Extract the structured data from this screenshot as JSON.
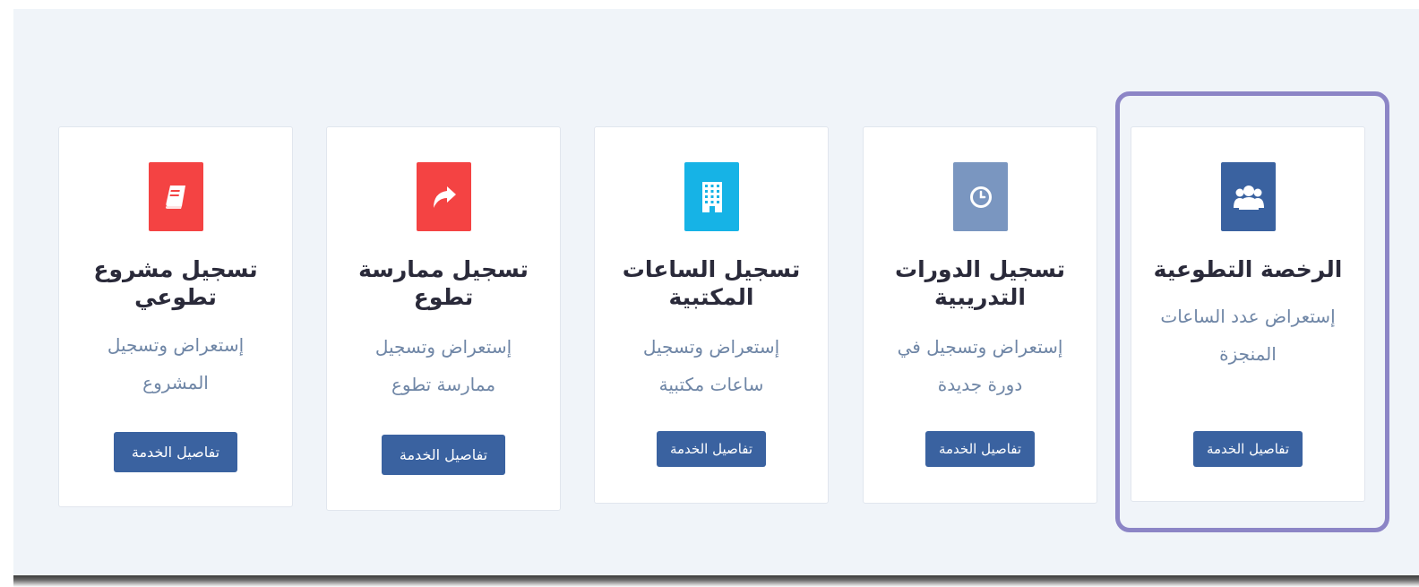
{
  "colors": {
    "background": "#f0f4f9",
    "button": "#3a62a0",
    "highlight": "#8c85c6",
    "description": "#6f86a6"
  },
  "services": [
    {
      "icon": "users-icon",
      "icon_color": "#3a62a0",
      "title_lines": [
        "الرخصة التطوعية"
      ],
      "desc_lines": [
        "إستعراض عدد الساعات",
        "المنجزة"
      ],
      "button_label": "تفاصيل الخدمة"
    },
    {
      "icon": "clock-icon",
      "icon_color": "#7a96c0",
      "title_lines": [
        "تسجيل الدورات",
        "التدريبية"
      ],
      "desc_lines": [
        "إستعراض وتسجيل في",
        "دورة جديدة"
      ],
      "button_label": "تفاصيل الخدمة"
    },
    {
      "icon": "building-icon",
      "icon_color": "#16b3e6",
      "title_lines": [
        "تسجيل الساعات",
        "المكتبية"
      ],
      "desc_lines": [
        "إستعراض وتسجيل",
        "ساعات مكتبية"
      ],
      "button_label": "تفاصيل الخدمة"
    },
    {
      "icon": "share-arrow-icon",
      "icon_color": "#f44343",
      "title_lines": [
        "تسجيل ممارسة",
        "تطوع"
      ],
      "desc_lines": [
        "إستعراض وتسجيل",
        "ممارسة تطوع"
      ],
      "button_label": "تفاصيل الخدمة"
    },
    {
      "icon": "book-icon",
      "icon_color": "#f44343",
      "title_lines": [
        "تسجيل مشروع",
        "تطوعي"
      ],
      "desc_lines": [
        "إستعراض وتسجيل",
        "المشروع"
      ],
      "button_label": "تفاصيل الخدمة"
    }
  ]
}
